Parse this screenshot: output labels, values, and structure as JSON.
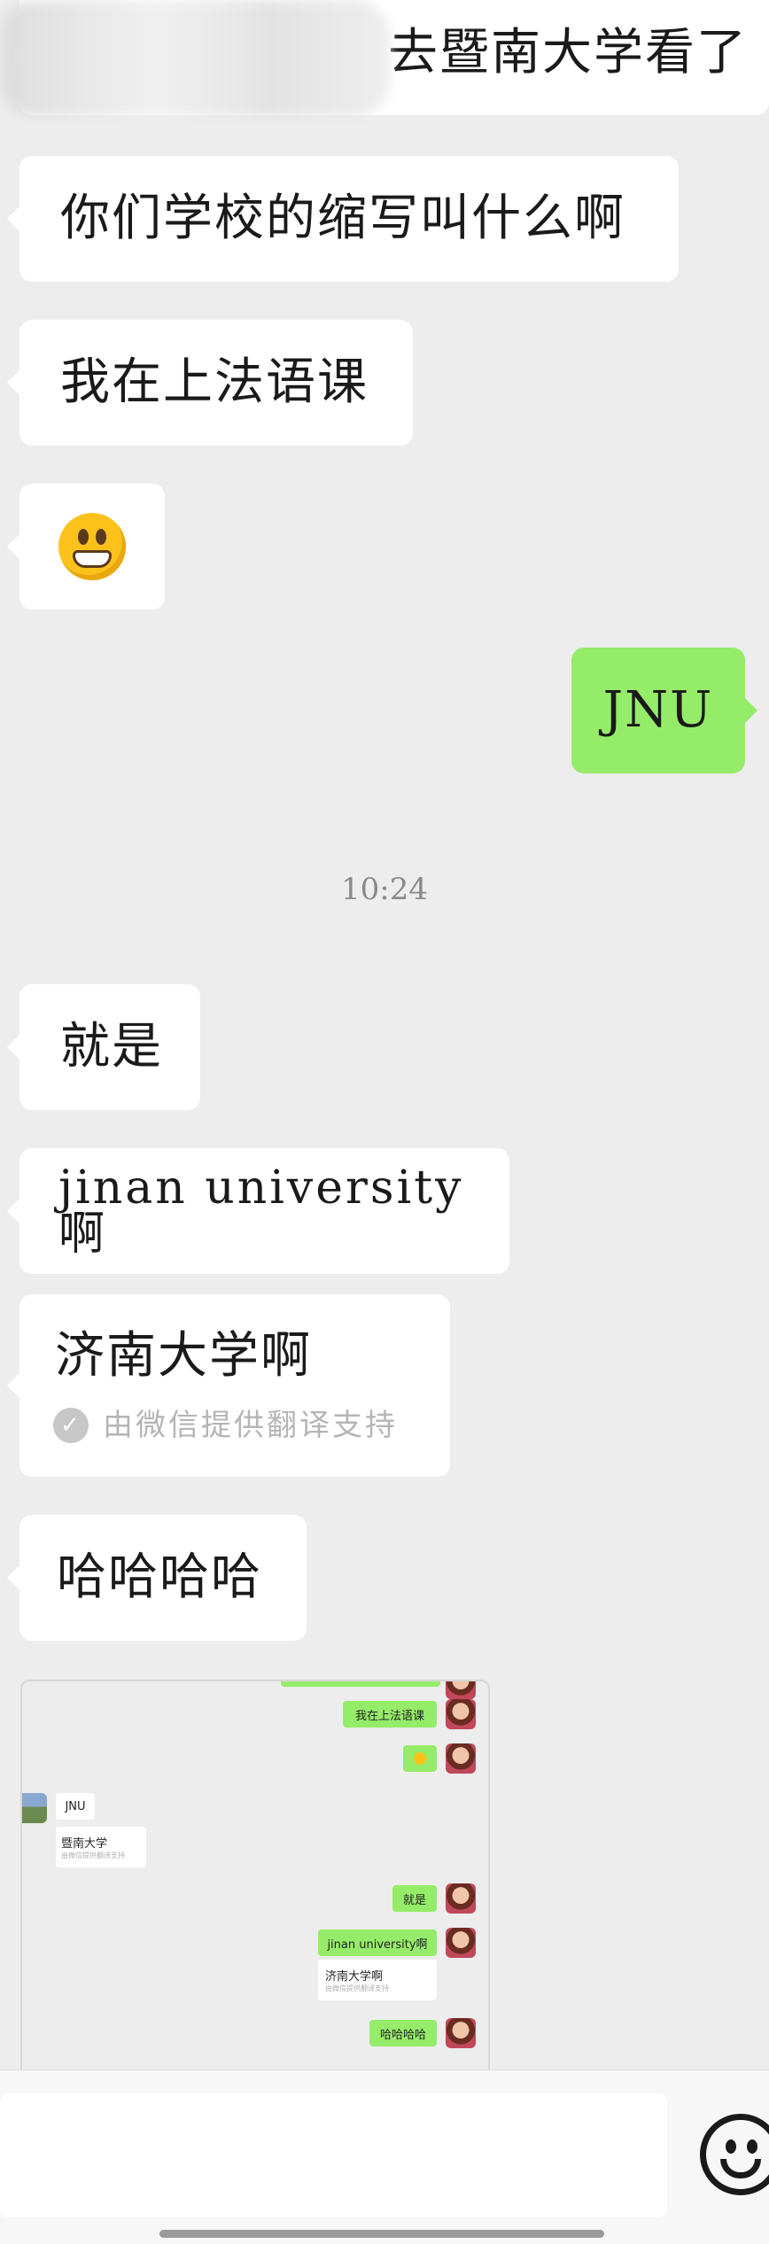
{
  "messages": {
    "top_partial": "去暨南大学看了",
    "m1": "你们学校的缩写叫什么啊",
    "m2": "我在上法语课",
    "m3_emoji": "grinning-face-emoji",
    "m4_sent": "JNU",
    "timestamp": "10:24",
    "m5": "就是",
    "m6": "jinan university 啊",
    "m7": "济南大学啊",
    "m7_translation": "由微信提供翻译支持",
    "m8": "哈哈哈哈"
  },
  "embedded_screenshot": {
    "b1": "我在上法语课",
    "b2_sent": "JNU",
    "b3": "暨南大学",
    "b3_translation": "由微信提供翻译支持",
    "b4": "就是",
    "b5": "jinan university啊",
    "b6": "济南大学啊",
    "b6_translation": "由微信提供翻译支持",
    "b7": "哈哈哈哈"
  },
  "colors": {
    "background": "#ededed",
    "incoming_bubble": "#ffffff",
    "outgoing_bubble": "#95ec69",
    "timestamp_text": "#8a8a8a"
  },
  "input_bar": {
    "emoji_button_icon": "smiley-icon"
  }
}
